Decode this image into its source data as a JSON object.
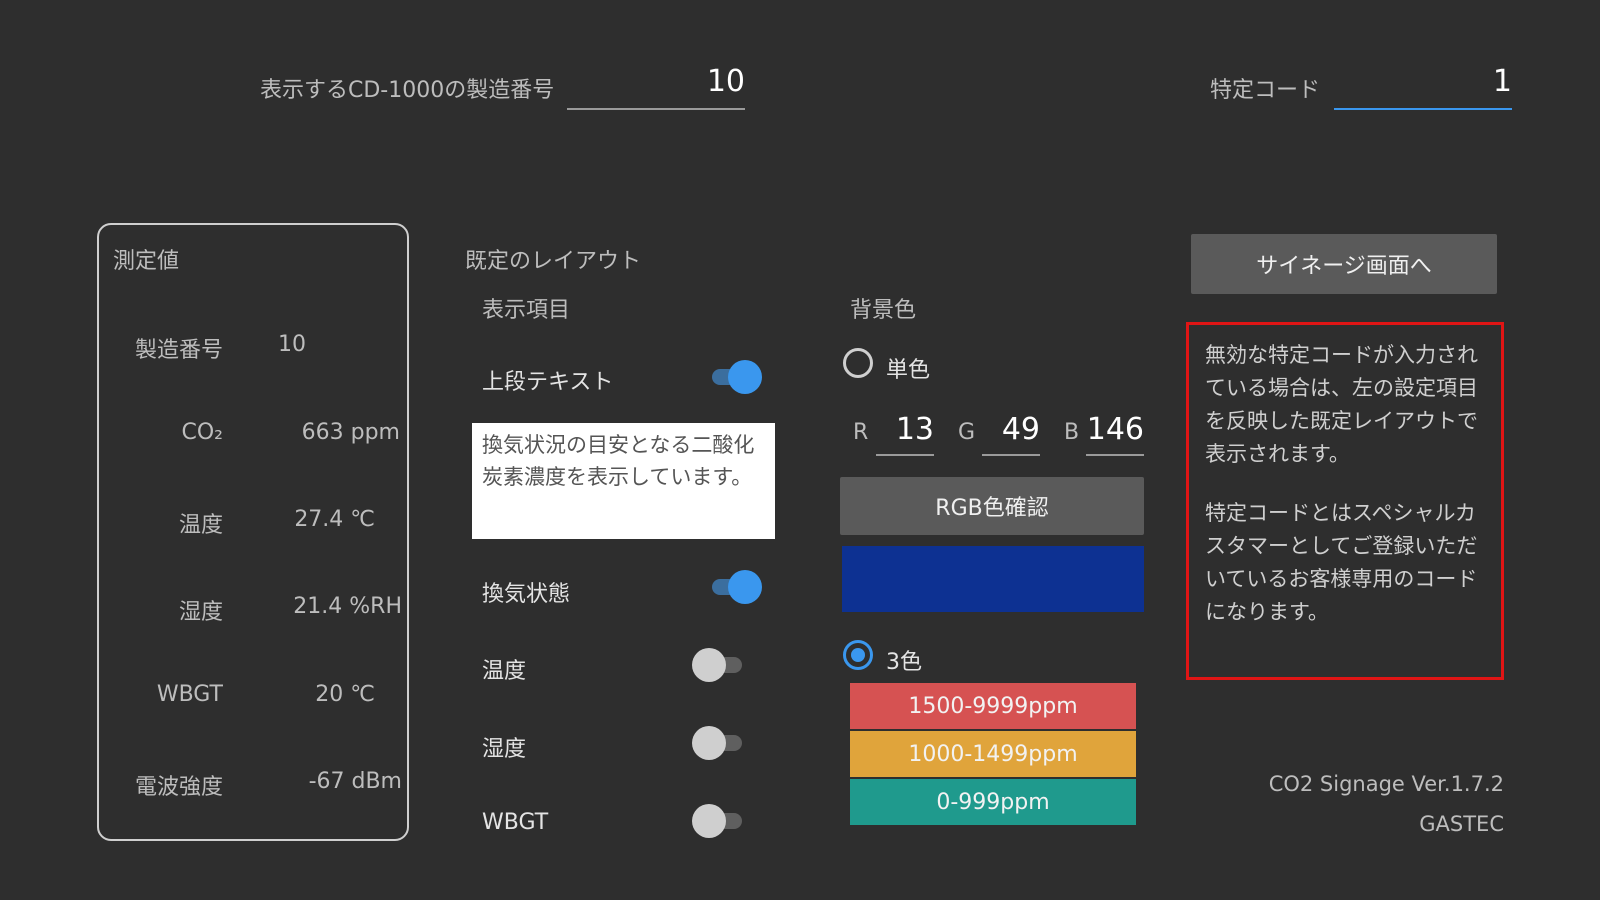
{
  "header": {
    "serial_label": "表示するCD-1000の製造番号",
    "serial_value": "10",
    "code_label": "特定コード",
    "code_value": "1"
  },
  "measurements": {
    "title": "測定値",
    "rows": [
      {
        "label": "製造番号",
        "value": "10"
      },
      {
        "label": "CO₂",
        "value": "663 ppm"
      },
      {
        "label": "温度",
        "value": "27.4 ℃"
      },
      {
        "label": "湿度",
        "value": "21.4 %RH"
      },
      {
        "label": "WBGT",
        "value": "20 ℃"
      },
      {
        "label": "電波強度",
        "value": "-67 dBm"
      }
    ]
  },
  "layout": {
    "title": "既定のレイアウト",
    "display_items_label": "表示項目",
    "items": [
      {
        "label": "上段テキスト",
        "on": true
      },
      {
        "label": "換気状態",
        "on": true
      },
      {
        "label": "温度",
        "on": false
      },
      {
        "label": "湿度",
        "on": false
      },
      {
        "label": "WBGT",
        "on": false
      }
    ],
    "top_text": "換気状況の目安となる二酸化炭素濃度を表示しています。"
  },
  "background": {
    "label": "背景色",
    "single_label": "単色",
    "single_selected": false,
    "r_label": "R",
    "r_value": "13",
    "g_label": "G",
    "g_value": "49",
    "b_label": "B",
    "b_value": "146",
    "check_button": "RGB色確認",
    "preview_color": "#0d3192",
    "three_label": "3色",
    "three_selected": true,
    "bands": [
      {
        "label": "1500-9999ppm",
        "color": "#d65252"
      },
      {
        "label": "1000-1499ppm",
        "color": "#e0a43b"
      },
      {
        "label": "0-999ppm",
        "color": "#1f9a8d"
      }
    ]
  },
  "actions": {
    "signage_button": "サイネージ画面へ"
  },
  "info": {
    "paragraph1": "無効な特定コードが入力されている場合は、左の設定項目を反映した既定レイアウトで表示されます。",
    "paragraph2": "特定コードとはスペシャルカスタマーとしてご登録いただいているお客様専用のコードになります。"
  },
  "footer": {
    "version": "CO2 Signage Ver.1.7.2",
    "company": "GASTEC"
  },
  "colors": {
    "accent": "#3a97ee",
    "warning_border": "#e01515",
    "background": "#2e2e2e"
  }
}
